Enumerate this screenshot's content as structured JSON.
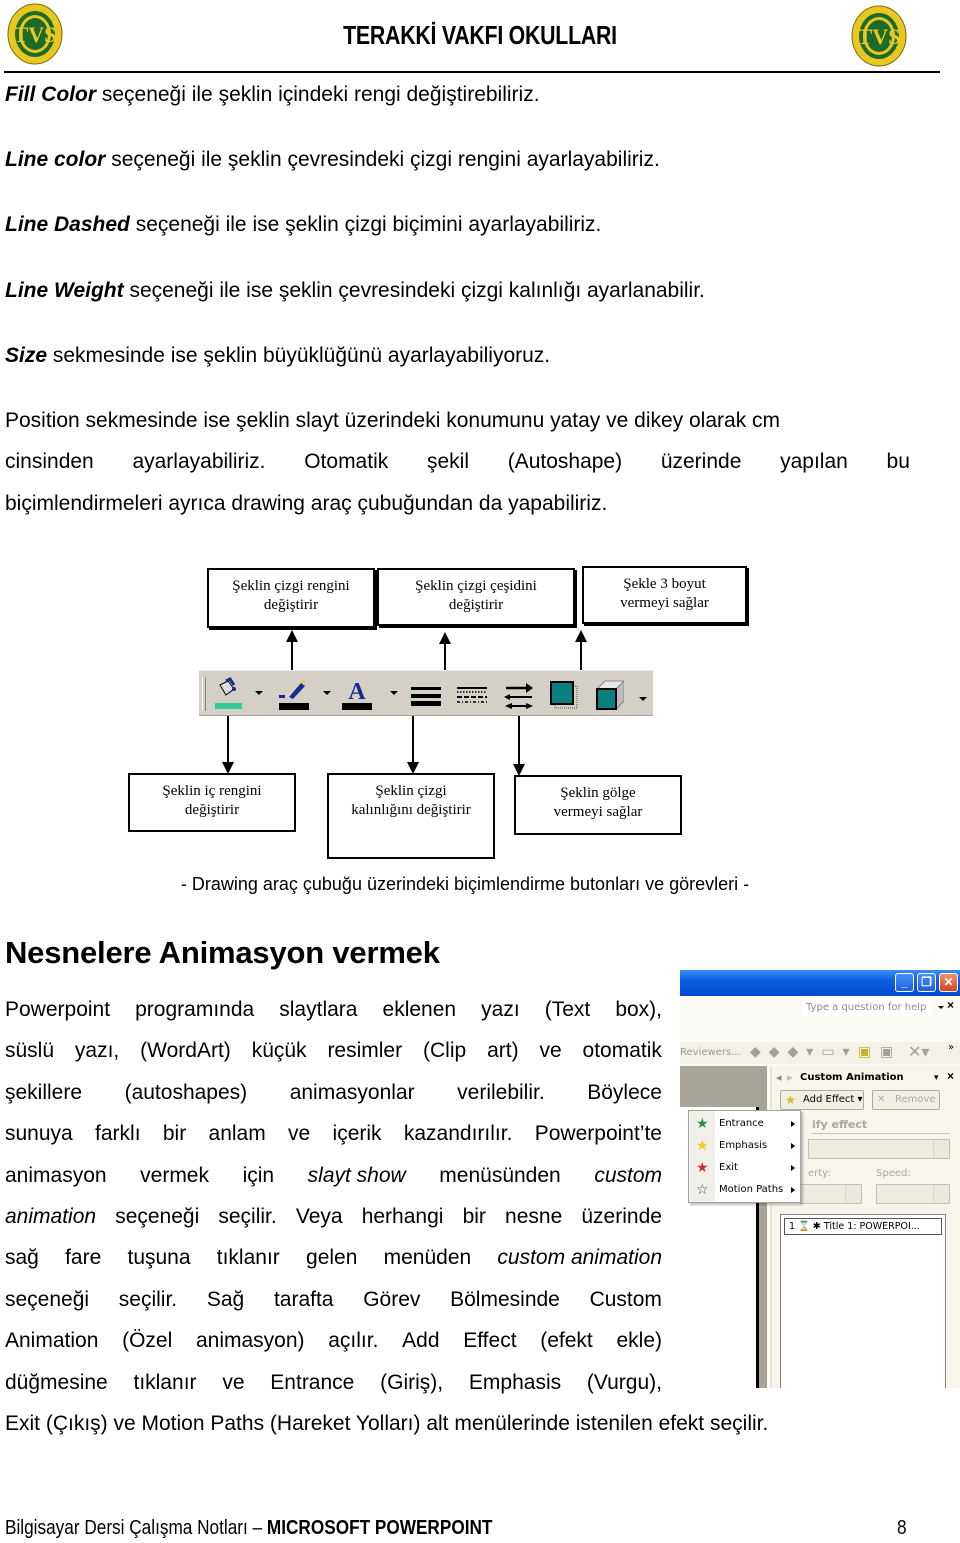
{
  "header": {
    "title": "TERAKKİ VAKFI OKULLARI",
    "logo_letters": "TVS"
  },
  "intro_lines": [
    {
      "term": "Fill Color",
      "text": " seçeneği ile şeklin içindeki rengi değiştirebiliriz."
    },
    {
      "term": "Line color",
      "text": " seçeneği ile şeklin çevresindeki çizgi rengini ayarlayabiliriz."
    },
    {
      "term": "Line Dashed",
      "text": " seçeneği ile ise şeklin çizgi biçimini ayarlayabiliriz."
    },
    {
      "term": "Line Weight",
      "text": " seçeneği ile ise şeklin çevresindeki çizgi kalınlığı ayarlanabilir."
    },
    {
      "term": "Size",
      "text": " sekmesinde ise şeklin büyüklüğünü ayarlayabiliyoruz."
    }
  ],
  "position_paragraph": {
    "line1": "Position sekmesinde ise şeklin slayt üzerindeki konumunu yatay ve dikey olarak cm",
    "line2": "cinsinden ayarlayabiliriz. Otomatik şekil (Autoshape) üzerinde yapılan bu",
    "line3": "biçimlendirmeleri ayrıca drawing araç çubuğundan da yapabiliriz."
  },
  "diagram": {
    "top_callouts": [
      {
        "line1": "Şeklin çizgi rengini",
        "line2": "değiştirir"
      },
      {
        "line1": "Şeklin çizgi çeşidini",
        "line2": "değiştirir"
      },
      {
        "line1": "Şekle 3 boyut",
        "line2": "vermeyi sağlar"
      }
    ],
    "bottom_callouts": [
      {
        "line1": "Şeklin iç rengini",
        "line2": "değiştirir"
      },
      {
        "line1": "Şeklin çizgi",
        "line2": "kalınlığını değiştirir"
      },
      {
        "line1": "Şeklin gölge",
        "line2": "vermeyi sağlar"
      }
    ],
    "toolbar_buttons": [
      {
        "name": "fill-color",
        "color": "#33cc99",
        "has_dropdown": true
      },
      {
        "name": "line-color",
        "color": "#000000",
        "has_dropdown": true
      },
      {
        "name": "font-color",
        "color": "#000000",
        "has_dropdown": true
      },
      {
        "name": "line-style",
        "has_dropdown": false
      },
      {
        "name": "dash-style",
        "has_dropdown": false
      },
      {
        "name": "arrow-style",
        "has_dropdown": false
      },
      {
        "name": "shadow-style",
        "has_dropdown": false
      },
      {
        "name": "3d-style",
        "has_dropdown": true
      }
    ],
    "caption": "- Drawing araç çubuğu üzerindeki biçimlendirme butonları ve görevleri -"
  },
  "section": {
    "heading": "Nesnelere Animasyon vermek",
    "lines": [
      [
        "Powerpoint",
        "programında",
        "slaytlara",
        "eklenen",
        "yazı",
        "(Text",
        "box),"
      ],
      [
        "süslü",
        "yazı,",
        "(WordArt)",
        "küçük",
        "resimler",
        "(Clip",
        "art)",
        "ve",
        "otomatik"
      ],
      [
        "şekillere",
        "(autoshapes)",
        "animasyonlar",
        "verilebilir.",
        "Böylece"
      ],
      [
        "sunuya",
        "farklı",
        "bir",
        "anlam",
        "ve",
        "içerik",
        "kazandırılır.",
        "Powerpoint’te"
      ],
      [
        "animasyon",
        "vermek",
        "için",
        "*slayt show*",
        "menüsünden",
        "*custom*"
      ],
      [
        "*animation*",
        "seçeneği",
        "seçilir.",
        "Veya",
        "herhangi",
        "bir",
        "nesne",
        "üzerinde"
      ],
      [
        "sağ",
        "fare",
        "tuşuna",
        "tıklanır",
        "gelen",
        "menüden",
        "*custom animation*"
      ],
      [
        "seçeneği",
        "seçilir.",
        "Sağ",
        "tarafta",
        "Görev",
        "Bölmesinde",
        "Custom"
      ],
      [
        "Animation",
        "(Özel",
        "animasyon)",
        "açılır.",
        "Add",
        "Effect",
        "(efekt",
        "ekle)"
      ],
      [
        "düğmesine",
        "tıklanır",
        "ve",
        "Entrance",
        "(Giriş),",
        "Emphasis",
        "(Vurgu),"
      ]
    ],
    "last_line": "Exit (Çıkış) ve Motion Paths (Hareket Yolları) alt menülerinde istenilen efekt seçilir."
  },
  "powerpoint_screenshot": {
    "window_buttons": {
      "minimize": "_",
      "restore": "❐",
      "close": "✕"
    },
    "help_placeholder": "Type a question for help",
    "toolbar_text": "Reviewers...",
    "task_pane_title": "Custom Animation",
    "add_effect_label": "Add Effect ▾",
    "remove_label": "Remove",
    "modify_label": "ify effect",
    "property_label": "erty:",
    "speed_label": "Speed:",
    "menu_items": [
      {
        "label": "Entrance",
        "star_color": "#2e8b3e"
      },
      {
        "label": "Emphasis",
        "star_color": "#e6d21e"
      },
      {
        "label": "Exit",
        "star_color": "#d8262e"
      },
      {
        "label": "Motion Paths",
        "star_color": "#ffffff"
      }
    ],
    "list_item": "1 ⌛ ✱ Title 1: POWERPOI..."
  },
  "footer": {
    "text": "Bilgisayar Dersi Çalışma Notları – ",
    "bold": "MICROSOFT POWERPOINT",
    "page_number": "8"
  }
}
